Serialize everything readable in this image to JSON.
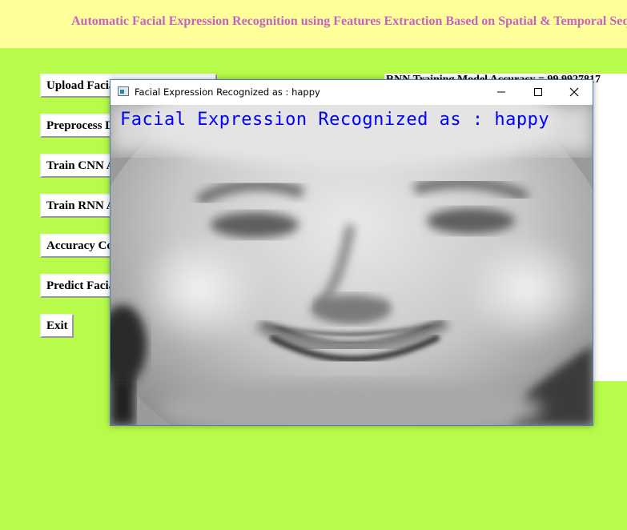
{
  "app": {
    "title": "Automatic Facial Expression Recognition using Features Extraction Based on Spatial & Temporal Sequences"
  },
  "buttons": {
    "upload": "Upload Facial Expression Dataset",
    "preprocess": "Preprocess Dataset",
    "train_cnn": "Train CNN Algorithm",
    "train_rnn": "Train RNN Algorithm",
    "accuracy": "Accuracy Comparison Graph",
    "predict": "Predict Facial Expression",
    "exit": "Exit"
  },
  "text_panel": {
    "line1": "RNN Training Model Accuracy = 99.9927817"
  },
  "cv_window": {
    "title": "Facial Expression Recognized as : happy",
    "overlay_text": "Facial Expression Recognized as : happy",
    "controls": {
      "minimize": "minimize-icon",
      "maximize": "maximize-icon",
      "close": "close-icon"
    }
  },
  "colors": {
    "background": "#b8fb4a",
    "title_band": "#ffff99",
    "title_text": "#c562c5",
    "overlay_text": "#0000ff"
  }
}
